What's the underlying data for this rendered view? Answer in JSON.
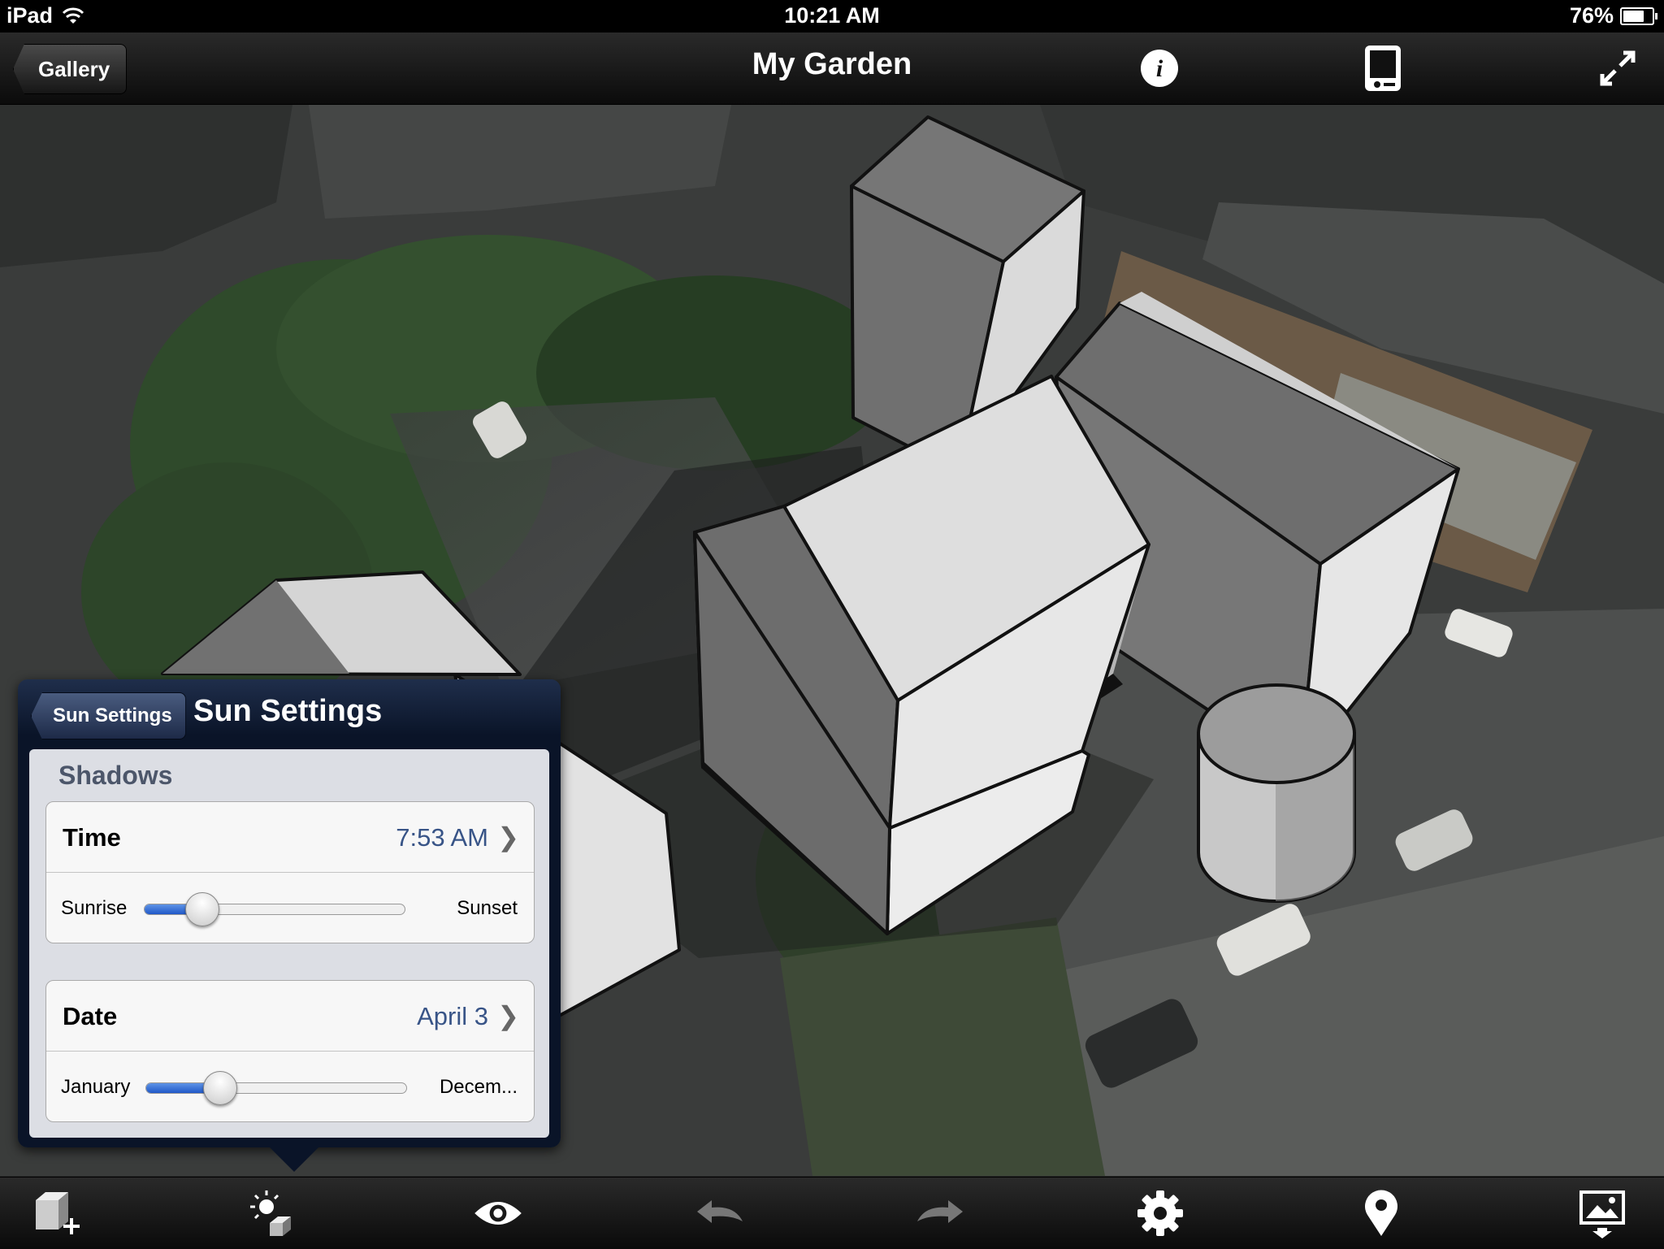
{
  "status_bar": {
    "device": "iPad",
    "time": "10:21 AM",
    "battery": "76%",
    "battery_level": 0.76
  },
  "nav": {
    "back_label": "Gallery",
    "title": "My Garden",
    "icons": [
      "info-icon",
      "device-icon",
      "fullscreen-icon"
    ]
  },
  "popover": {
    "back_label": "Sun Settings",
    "title": "Sun Settings",
    "section": "Shadows",
    "time": {
      "label": "Time",
      "value": "7:53 AM",
      "min_label": "Sunrise",
      "max_label": "Sunset",
      "level": 0.22
    },
    "date": {
      "label": "Date",
      "value": "April 3",
      "min_label": "January",
      "max_label": "Decem...",
      "level": 0.28
    }
  },
  "toolbar": {
    "icons": [
      "add-model-icon",
      "sun-settings-icon",
      "view-icon",
      "undo-icon",
      "redo-icon",
      "settings-icon",
      "location-icon",
      "export-icon"
    ]
  }
}
